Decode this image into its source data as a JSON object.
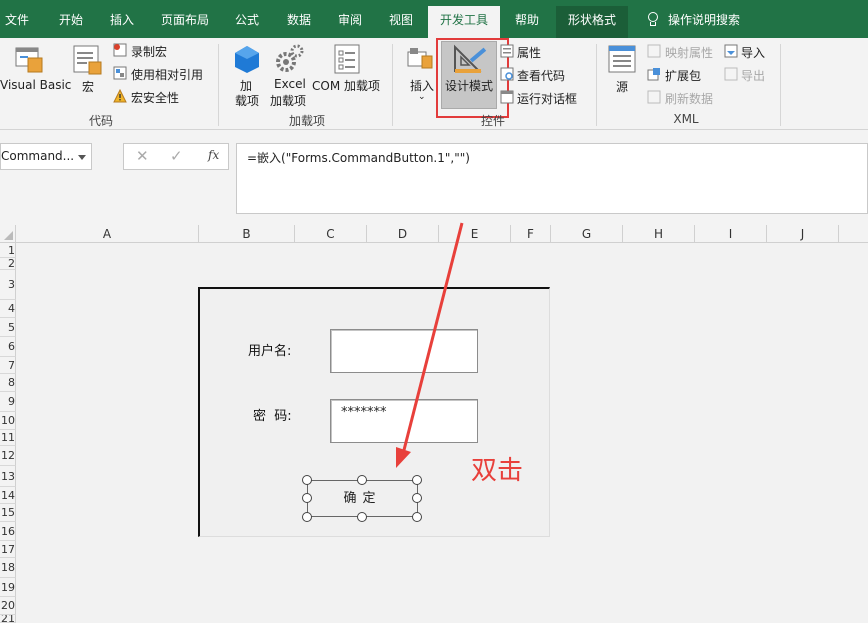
{
  "ribbon_tabs": [
    "文件",
    "开始",
    "插入",
    "页面布局",
    "公式",
    "数据",
    "审阅",
    "视图",
    "开发工具",
    "帮助",
    "形状格式"
  ],
  "tell_me": "操作说明搜索",
  "groups": {
    "code": {
      "label": "代码",
      "visual_basic": "Visual Basic",
      "macros": "宏",
      "record_macro": "录制宏",
      "relative_ref": "使用相对引用",
      "macro_security": "宏安全性"
    },
    "addins": {
      "label": "加载项",
      "addins_line1": "加",
      "addins_line2": "载项",
      "excel_addins_line1": "Excel",
      "excel_addins_line2": "加载项",
      "com_addins": "COM 加载项"
    },
    "controls": {
      "label": "控件",
      "insert": "插入",
      "design_mode": "设计模式",
      "properties": "属性",
      "view_code": "查看代码",
      "run_dialog": "运行对话框"
    },
    "xml": {
      "label": "XML",
      "source": "源",
      "map_properties": "映射属性",
      "expansion_packs": "扩展包",
      "refresh_data": "刷新数据",
      "import": "导入",
      "export": "导出"
    }
  },
  "formula_bar": {
    "name_box": "Command...",
    "formula": "=嵌入(\"Forms.CommandButton.1\",\"\")",
    "fx": "fx"
  },
  "columns": [
    "A",
    "B",
    "C",
    "D",
    "E",
    "F",
    "G",
    "H",
    "I",
    "J"
  ],
  "rows": [
    "1",
    "2",
    "3",
    "4",
    "5",
    "6",
    "7",
    "8",
    "9",
    "10",
    "11",
    "12",
    "13",
    "14",
    "15",
    "16",
    "17",
    "18",
    "19",
    "20",
    "21"
  ],
  "form": {
    "username_label": "用户名:",
    "password_label": "密  码:",
    "username_value": "",
    "password_value": "*******",
    "button_label": "确定"
  },
  "annotation": "双击",
  "colors": {
    "accent": "#217346",
    "highlight": "#e23b3b"
  }
}
